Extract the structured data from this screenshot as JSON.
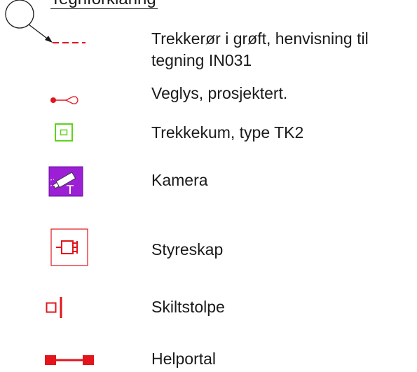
{
  "legend": {
    "heading": "Tegnforklaring",
    "items": [
      {
        "symbol": "trekkeror-i-groft-symbol",
        "label_lines": [
          "Trekkerør i grøft, henvisning til",
          "tegning IN031"
        ]
      },
      {
        "symbol": "veglys-symbol",
        "label_lines": [
          "Veglys, prosjektert."
        ]
      },
      {
        "symbol": "trekkekum-symbol",
        "label_lines": [
          "Trekkekum, type TK2"
        ]
      },
      {
        "symbol": "kamera-symbol",
        "label_lines": [
          "Kamera"
        ]
      },
      {
        "symbol": "styreskap-symbol",
        "label_lines": [
          "Styreskap"
        ]
      },
      {
        "symbol": "skiltstolpe-symbol",
        "label_lines": [
          "Skiltstolpe"
        ]
      },
      {
        "symbol": "helportal-symbol",
        "label_lines": [
          "Helportal"
        ]
      }
    ]
  },
  "colors": {
    "red": "#e3141c",
    "green": "#5fd21e",
    "purple": "#9c1fd6",
    "text": "#1a1a1a"
  }
}
